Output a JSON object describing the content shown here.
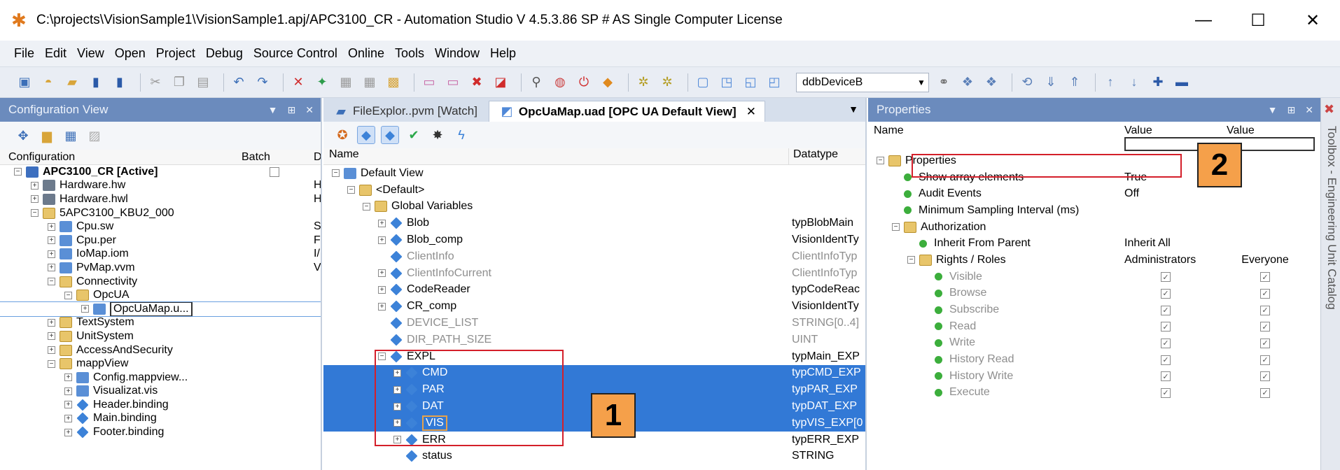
{
  "window": {
    "title": "C:\\projects\\VisionSample1\\VisionSample1.apj/APC3100_CR - Automation Studio V 4.5.3.86 SP # AS Single Computer License",
    "min": "—",
    "max": "☐",
    "close": "✕"
  },
  "menu": [
    "File",
    "Edit",
    "View",
    "Open",
    "Project",
    "Debug",
    "Source Control",
    "Online",
    "Tools",
    "Window",
    "Help"
  ],
  "toolbar": {
    "device_combo": "ddbDeviceB"
  },
  "config_view": {
    "title": "Configuration View",
    "col_config": "Configuration",
    "col_batch": "Batch",
    "col_d": "D",
    "items": [
      {
        "label": "APC3100_CR [Active]",
        "bold": true,
        "level": 0,
        "exp": "−",
        "icon": "cfg",
        "side": ""
      },
      {
        "label": "Hardware.hw",
        "level": 1,
        "exp": "+",
        "icon": "hw",
        "side": "H"
      },
      {
        "label": "Hardware.hwl",
        "level": 1,
        "exp": "+",
        "icon": "hw",
        "side": "H"
      },
      {
        "label": "5APC3100_KBU2_000",
        "level": 1,
        "exp": "−",
        "icon": "folder",
        "side": ""
      },
      {
        "label": "Cpu.sw",
        "level": 2,
        "exp": "+",
        "icon": "sw",
        "side": "S"
      },
      {
        "label": "Cpu.per",
        "level": 2,
        "exp": "+",
        "icon": "sw",
        "side": "F"
      },
      {
        "label": "IoMap.iom",
        "level": 2,
        "exp": "+",
        "icon": "sw",
        "side": "I/"
      },
      {
        "label": "PvMap.vvm",
        "level": 2,
        "exp": "+",
        "icon": "sw",
        "side": "V"
      },
      {
        "label": "Connectivity",
        "level": 2,
        "exp": "−",
        "icon": "folder",
        "side": ""
      },
      {
        "label": "OpcUA",
        "level": 3,
        "exp": "−",
        "icon": "folder",
        "side": ""
      },
      {
        "label": "OpcUaMap.u...",
        "level": 4,
        "exp": "+",
        "icon": "sw",
        "side": "",
        "edit": true
      },
      {
        "label": "TextSystem",
        "level": 2,
        "exp": "+",
        "icon": "folder",
        "side": ""
      },
      {
        "label": "UnitSystem",
        "level": 2,
        "exp": "+",
        "icon": "folder",
        "side": ""
      },
      {
        "label": "AccessAndSecurity",
        "level": 2,
        "exp": "+",
        "icon": "folder",
        "side": ""
      },
      {
        "label": "mappView",
        "level": 2,
        "exp": "−",
        "icon": "folder",
        "side": ""
      },
      {
        "label": "Config.mappview...",
        "level": 3,
        "exp": "+",
        "icon": "sw",
        "side": ""
      },
      {
        "label": "Visualizat.vis",
        "level": 3,
        "exp": "+",
        "icon": "sw",
        "side": ""
      },
      {
        "label": "Header.binding",
        "level": 3,
        "exp": "+",
        "icon": "diamond",
        "side": ""
      },
      {
        "label": "Main.binding",
        "level": 3,
        "exp": "+",
        "icon": "diamond",
        "side": ""
      },
      {
        "label": "Footer.binding",
        "level": 3,
        "exp": "+",
        "icon": "diamond",
        "side": ""
      }
    ]
  },
  "tabs": [
    {
      "label": "FileExplor..pvm [Watch]",
      "active": false
    },
    {
      "label": "OpcUaMap.uad [OPC UA Default View]",
      "active": true,
      "close": "✕"
    }
  ],
  "opcua": {
    "col_name": "Name",
    "col_type": "Datatype",
    "rows": [
      {
        "name": "Default View",
        "type": "",
        "level": 0,
        "exp": "−",
        "icon": "sw",
        "state": ""
      },
      {
        "name": "<Default>",
        "type": "",
        "level": 1,
        "exp": "−",
        "icon": "folder",
        "state": ""
      },
      {
        "name": "Global Variables",
        "type": "",
        "level": 2,
        "exp": "−",
        "icon": "folder",
        "state": ""
      },
      {
        "name": "Blob",
        "type": "typBlobMain",
        "level": 3,
        "exp": "+",
        "icon": "diamond",
        "state": ""
      },
      {
        "name": "Blob_comp",
        "type": "VisionIdentTy",
        "level": 3,
        "exp": "+",
        "icon": "diamond",
        "state": ""
      },
      {
        "name": "ClientInfo",
        "type": "ClientInfoTyp",
        "level": 3,
        "exp": "",
        "icon": "diamond",
        "state": "grey"
      },
      {
        "name": "ClientInfoCurrent",
        "type": "ClientInfoTyp",
        "level": 3,
        "exp": "+",
        "icon": "diamond",
        "state": "grey"
      },
      {
        "name": "CodeReader",
        "type": "typCodeReac",
        "level": 3,
        "exp": "+",
        "icon": "diamond",
        "state": ""
      },
      {
        "name": "CR_comp",
        "type": "VisionIdentTy",
        "level": 3,
        "exp": "+",
        "icon": "diamond",
        "state": ""
      },
      {
        "name": "DEVICE_LIST",
        "type": "STRING[0..4]",
        "level": 3,
        "exp": "",
        "icon": "diamond",
        "state": "grey"
      },
      {
        "name": "DIR_PATH_SIZE",
        "type": "UINT",
        "level": 3,
        "exp": "",
        "icon": "diamond",
        "state": "grey"
      },
      {
        "name": "EXPL",
        "type": "typMain_EXP",
        "level": 3,
        "exp": "−",
        "icon": "diamond",
        "state": ""
      },
      {
        "name": "CMD",
        "type": "typCMD_EXP",
        "level": 4,
        "exp": "+",
        "icon": "diamond",
        "state": "sel"
      },
      {
        "name": "PAR",
        "type": "typPAR_EXP",
        "level": 4,
        "exp": "+",
        "icon": "diamond",
        "state": "sel"
      },
      {
        "name": "DAT",
        "type": "typDAT_EXP",
        "level": 4,
        "exp": "+",
        "icon": "diamond",
        "state": "sel"
      },
      {
        "name": "VIS",
        "type": "typVIS_EXP[0",
        "level": 4,
        "exp": "+",
        "icon": "diamond",
        "state": "sel"
      },
      {
        "name": "ERR",
        "type": "typERR_EXP",
        "level": 4,
        "exp": "+",
        "icon": "diamond",
        "state": ""
      },
      {
        "name": "status",
        "type": "STRING",
        "level": 4,
        "exp": "",
        "icon": "diamond",
        "state": ""
      }
    ]
  },
  "properties": {
    "title": "Properties",
    "col_name": "Name",
    "col_value": "Value",
    "col_value2": "Value",
    "rows": [
      {
        "name": "Properties",
        "v1": "",
        "v2": "",
        "level": 0,
        "exp": "−",
        "icon": "folder",
        "grey": false
      },
      {
        "name": "Show array elements",
        "v1": "True",
        "v2": "",
        "level": 1,
        "exp": "",
        "icon": "green",
        "grey": false
      },
      {
        "name": "Audit Events",
        "v1": "Off",
        "v2": "",
        "level": 1,
        "exp": "",
        "icon": "green",
        "grey": false
      },
      {
        "name": "Minimum Sampling Interval (ms)",
        "v1": "",
        "v2": "",
        "level": 1,
        "exp": "",
        "icon": "green",
        "grey": false
      },
      {
        "name": "Authorization",
        "v1": "",
        "v2": "",
        "level": 1,
        "exp": "−",
        "icon": "folder",
        "grey": false
      },
      {
        "name": "Inherit From Parent",
        "v1": "Inherit All",
        "v2": "",
        "level": 2,
        "exp": "",
        "icon": "green",
        "grey": false
      },
      {
        "name": "Rights / Roles",
        "v1": "Administrators",
        "v2": "Everyone",
        "level": 2,
        "exp": "−",
        "icon": "folder",
        "grey": false
      },
      {
        "name": "Visible",
        "v1": "✓",
        "v2": "✓",
        "level": 3,
        "exp": "",
        "icon": "green",
        "grey": true,
        "check": true
      },
      {
        "name": "Browse",
        "v1": "✓",
        "v2": "✓",
        "level": 3,
        "exp": "",
        "icon": "green",
        "grey": true,
        "check": true
      },
      {
        "name": "Subscribe",
        "v1": "✓",
        "v2": "✓",
        "level": 3,
        "exp": "",
        "icon": "green",
        "grey": true,
        "check": true
      },
      {
        "name": "Read",
        "v1": "✓",
        "v2": "✓",
        "level": 3,
        "exp": "",
        "icon": "green",
        "grey": true,
        "check": true
      },
      {
        "name": "Write",
        "v1": "✓",
        "v2": "✓",
        "level": 3,
        "exp": "",
        "icon": "green",
        "grey": true,
        "check": true
      },
      {
        "name": "History Read",
        "v1": "✓",
        "v2": "✓",
        "level": 3,
        "exp": "",
        "icon": "green",
        "grey": true,
        "check": true
      },
      {
        "name": "History Write",
        "v1": "✓",
        "v2": "✓",
        "level": 3,
        "exp": "",
        "icon": "green",
        "grey": true,
        "check": true
      },
      {
        "name": "Execute",
        "v1": "✓",
        "v2": "✓",
        "level": 3,
        "exp": "",
        "icon": "green",
        "grey": true,
        "check": true
      }
    ]
  },
  "toolbox": {
    "label": "Toolbox - Engineering Unit Catalog"
  },
  "callouts": [
    "1",
    "2"
  ],
  "colors": {
    "panel_header": "#6b8bbd",
    "selection": "#3279d6",
    "callout": "#f5a04a",
    "highlight": "#d41f2a"
  }
}
